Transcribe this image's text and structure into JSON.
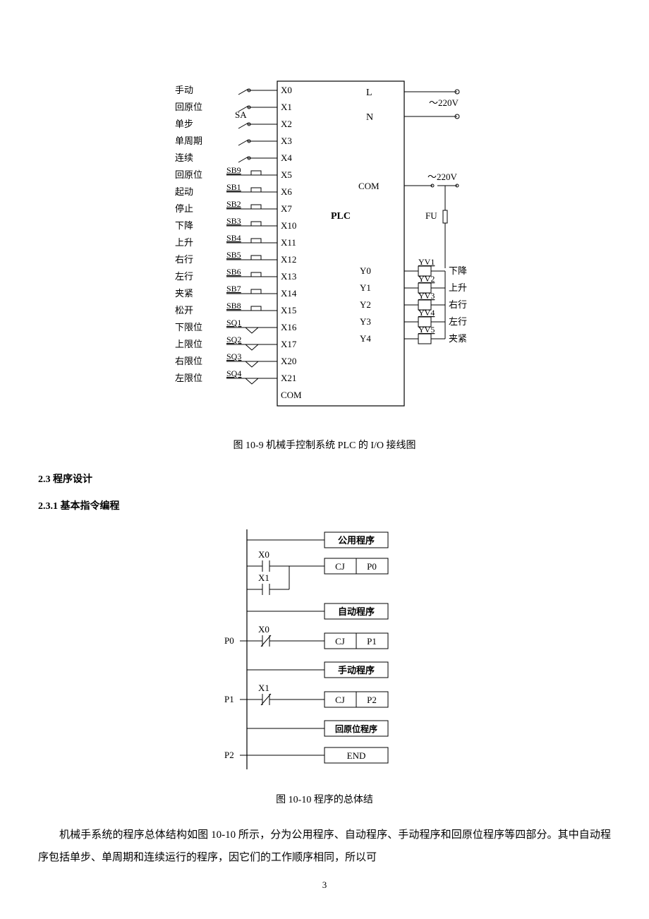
{
  "figure10_9": {
    "caption": "图 10-9   机械手控制系统 PLC 的 I/O 接线图",
    "plc_label": "PLC",
    "sa_label": "SA",
    "input_labels": [
      "手动",
      "回原位",
      "单步",
      "单周期",
      "连续",
      "回原位",
      "起动",
      "停止",
      "下降",
      "上升",
      "右行",
      "左行",
      "夹紧",
      "松开",
      "下限位",
      "上限位",
      "右限位",
      "左限位"
    ],
    "input_button_labels": [
      "",
      "",
      "",
      "",
      "",
      "SB9",
      "SB1",
      "SB2",
      "SB3",
      "SB4",
      "SB5",
      "SB6",
      "SB7",
      "SB8",
      "SQ1",
      "SQ2",
      "SQ3",
      "SQ4"
    ],
    "input_terminals": [
      "X0",
      "X1",
      "X2",
      "X3",
      "X4",
      "X5",
      "X6",
      "X7",
      "X10",
      "X11",
      "X12",
      "X13",
      "X14",
      "X15",
      "X16",
      "X17",
      "X20",
      "X21",
      "COM"
    ],
    "output_terminals": [
      "Y0",
      "Y1",
      "Y2",
      "Y3",
      "Y4"
    ],
    "output_relays": [
      "YV1",
      "YV2",
      "YV3",
      "YV4",
      "YV5"
    ],
    "output_labels": [
      "下降",
      "上升",
      "右行",
      "左行",
      "夹紧"
    ],
    "top_right": {
      "L": "L",
      "N": "N",
      "v220": "～220V",
      "com": "COM",
      "fu": "FU"
    }
  },
  "section_2_3": "2.3 程序设计",
  "section_2_3_1": "2.3.1  基本指令编程",
  "figure10_10": {
    "caption": "图 10-10   程序的总体结",
    "blocks": {
      "common": "公用程序",
      "auto": "自动程序",
      "manual": "手动程序",
      "return": "回原位程序",
      "end": "END"
    },
    "contacts": {
      "x0": "X0",
      "x1": "X1"
    },
    "jumps": {
      "cj": "CJ",
      "p0": "P0",
      "p1": "P1",
      "p2": "P2"
    }
  },
  "paragraph": "机械手系统的程序总体结构如图 10-10 所示，分为公用程序、自动程序、手动程序和回原位程序等四部分。其中自动程序包括单步、单周期和连续运行的程序，因它们的工作顺序相同，所以可",
  "page_number": "3"
}
